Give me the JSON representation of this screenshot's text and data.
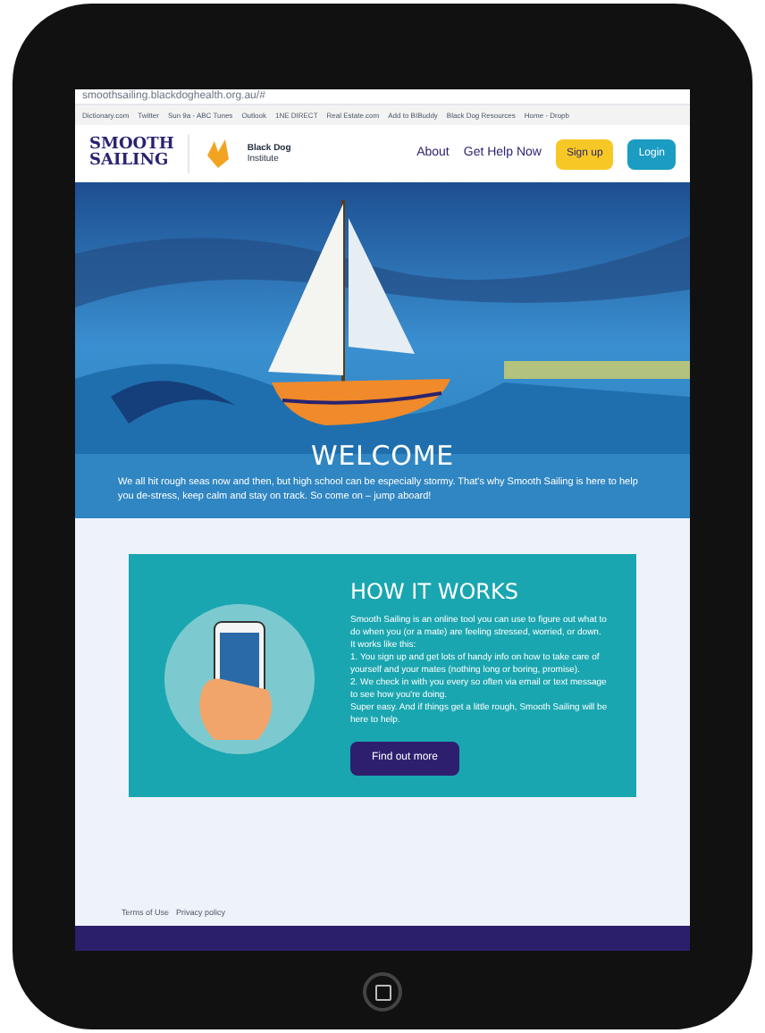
{
  "browser": {
    "url": "smoothsailing.blackdoghealth.org.au/#",
    "bookmarks": [
      "Dictionary.com",
      "Twitter",
      "Sun 9a - ABC Tunes",
      "Outlook",
      "1NE DIRECT",
      "Real Estate.com",
      "Add to BIBuddy",
      "Black Dog Resources",
      "Home - Dropb"
    ]
  },
  "nav": {
    "logo_line_1": "SMOOTH",
    "logo_line_2": "SAILING",
    "partner_name": "Black Dog",
    "partner_sub": "Institute",
    "links": [
      "About",
      "Get Help Now"
    ],
    "signup": "Sign up",
    "login": "Login"
  },
  "hero": {
    "title": "WELCOME",
    "text": "We all hit rough seas now and then, but high school can be especially stormy. That's why Smooth Sailing is here to help you de-stress, keep calm and stay on track. So come on – jump aboard!"
  },
  "how_it_works": {
    "title": "HOW IT WORKS",
    "paragraphs": [
      "Smooth Sailing is an online tool you can use to figure out what to do when you (or a mate) are feeling stressed, worried, or down.",
      "It works like this:",
      "1. You sign up and get lots of handy info on how to take care of yourself and your mates (nothing long or boring, promise).",
      "2. We check in with you every so often via email or text message to see how you're doing.",
      "Super easy. And if things get a little rough, Smooth Sailing will be here to help."
    ],
    "button": "Find out more"
  },
  "footer": {
    "links": [
      "Terms of Use",
      "Privacy policy"
    ]
  }
}
